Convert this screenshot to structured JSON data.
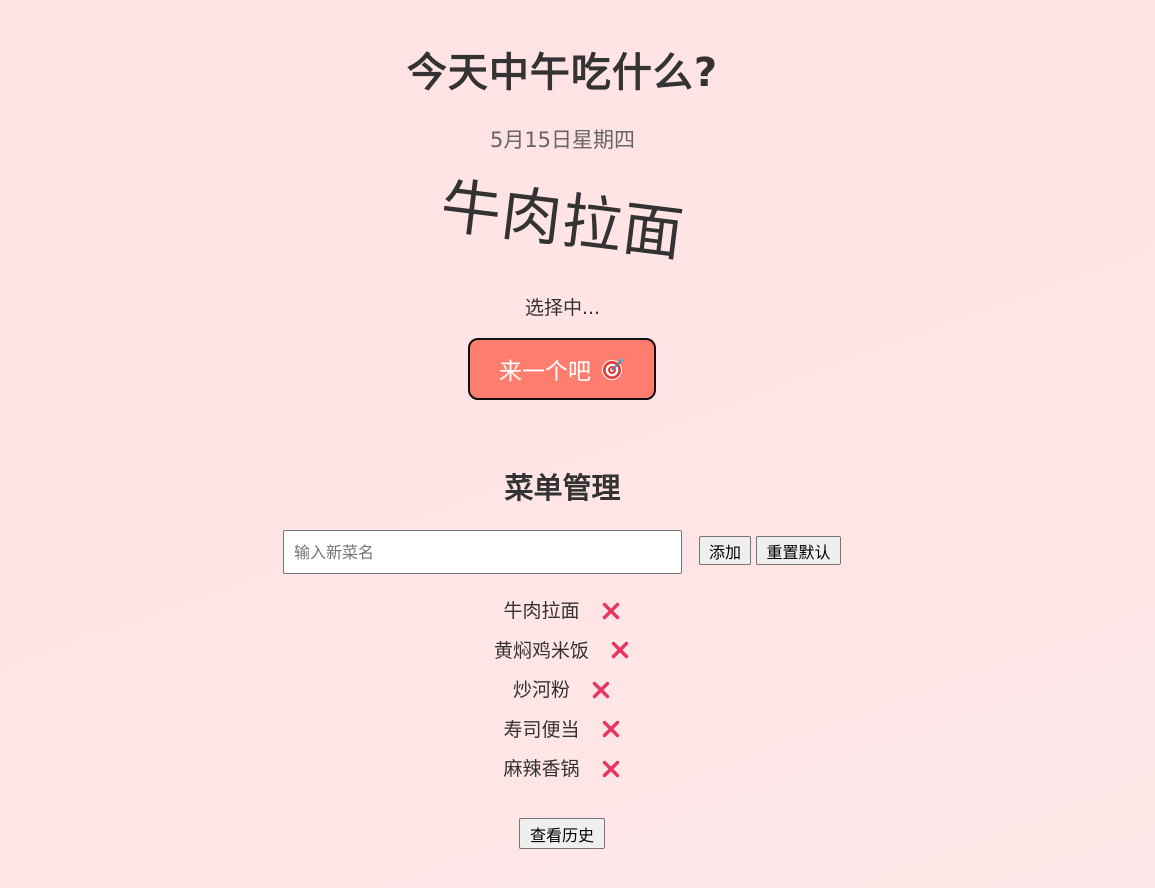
{
  "header": {
    "title": "今天中午吃什么?",
    "date": "5月15日星期四"
  },
  "picker": {
    "current_dish": "牛肉拉面",
    "status": "选择中...",
    "button_label": "来一个吧",
    "button_icon": "dart-target-icon"
  },
  "menu_management": {
    "title": "菜单管理",
    "input": {
      "value": "",
      "placeholder": "输入新菜名"
    },
    "add_label": "添加",
    "reset_label": "重置默认",
    "delete_icon": "close-icon",
    "items": [
      {
        "label": "牛肉拉面"
      },
      {
        "label": "黄焖鸡米饭"
      },
      {
        "label": "炒河粉"
      },
      {
        "label": "寿司便当"
      },
      {
        "label": "麻辣香锅"
      }
    ]
  },
  "history_label": "查看历史",
  "colors": {
    "background": "#ffe4e6",
    "accent_button": "#ff7d6f",
    "delete_icon": "#e8355f",
    "text": "#333333",
    "muted_text": "#666666"
  }
}
